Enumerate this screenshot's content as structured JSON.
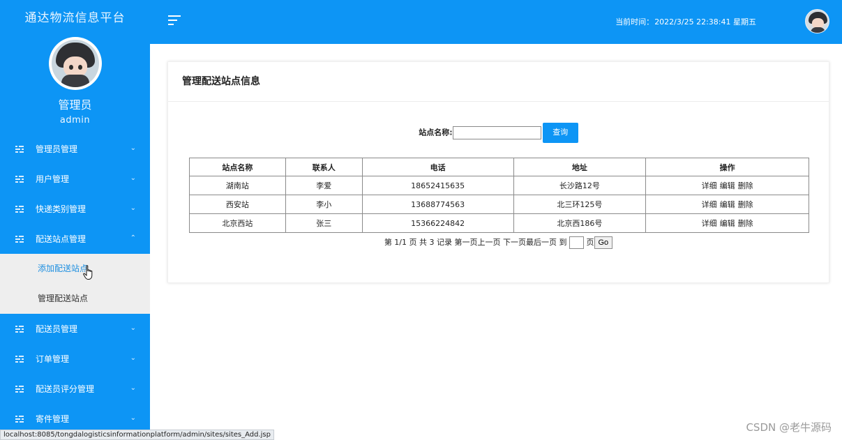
{
  "sidebar": {
    "brand": "通达物流信息平台",
    "role": "管理员",
    "username": "admin",
    "menu": [
      {
        "label": "管理员管理",
        "caret": "⌄"
      },
      {
        "label": "用户管理",
        "caret": "⌄"
      },
      {
        "label": "快递类别管理",
        "caret": "⌄"
      },
      {
        "label": "配送站点管理",
        "caret": "⌃"
      },
      {
        "label": "配送员管理",
        "caret": "⌄"
      },
      {
        "label": "订单管理",
        "caret": "⌄"
      },
      {
        "label": "配送员评分管理",
        "caret": "⌄"
      },
      {
        "label": "寄件管理",
        "caret": "⌄"
      }
    ],
    "submenu": [
      {
        "label": "添加配送站点"
      },
      {
        "label": "管理配送站点"
      }
    ]
  },
  "header": {
    "clock_label": "当前时间：",
    "clock_value": "2022/3/25 22:38:41 星期五"
  },
  "panel": {
    "title": "管理配送站点信息",
    "search_label": "站点名称:",
    "search_value": "",
    "search_button": "查询"
  },
  "table": {
    "headers": [
      "站点名称",
      "联系人",
      "电话",
      "地址",
      "操作"
    ],
    "rows": [
      {
        "name": "湖南站",
        "contact": "李爱",
        "phone": "18652415635",
        "address": "长沙路12号"
      },
      {
        "name": "西安站",
        "contact": "李小",
        "phone": "13688774563",
        "address": "北三环125号"
      },
      {
        "name": "北京西站",
        "contact": "张三",
        "phone": "15366224842",
        "address": "北京西186号"
      }
    ],
    "actions": [
      "详细",
      "编辑",
      "删除"
    ]
  },
  "pager": {
    "summary": "第 1/1 页 共 3 记录",
    "first": "第一页",
    "prev": "上一页",
    "next": "下一页",
    "last": "最后一页",
    "goto_prefix": "到",
    "goto_suffix": "页",
    "go_button": "Go"
  },
  "statusbar": {
    "url": "localhost:8085/tongdalogisticsinformationplatform/admin/sites/sites_Add.jsp"
  },
  "watermark": "CSDN @老牛源码",
  "colors": {
    "primary": "#0d95f5",
    "submenu_bg": "#eeeeee",
    "active_sub": "#1e8fe0"
  }
}
